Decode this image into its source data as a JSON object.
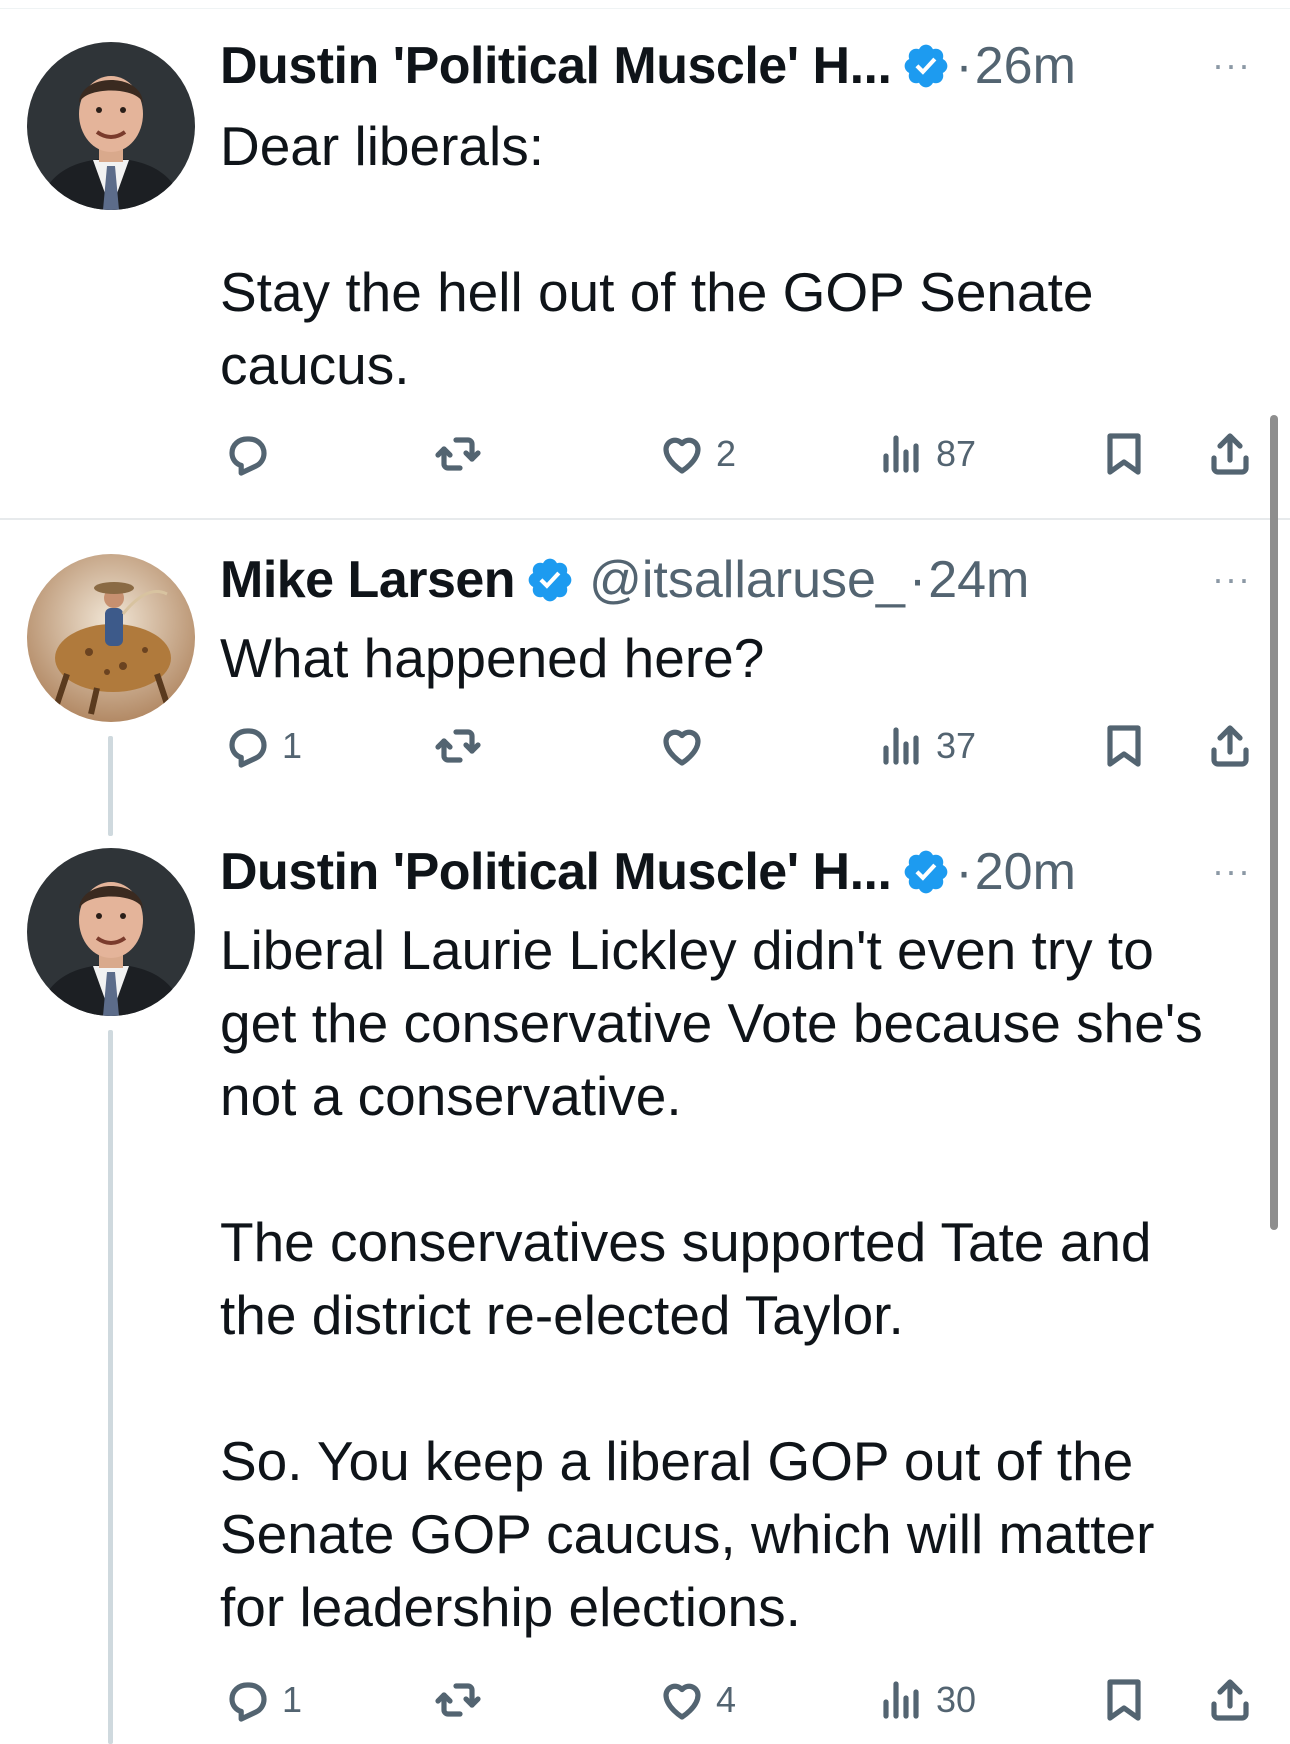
{
  "tweets": [
    {
      "author": "Dustin 'Political Muscle' H...",
      "handle": "",
      "separator": "·",
      "time": "26m",
      "more": "···",
      "paragraphs": [
        "Dear liberals:",
        "Stay the hell out of the GOP Senate caucus."
      ],
      "counts": {
        "replies": "",
        "retweets": "",
        "likes": "2",
        "views": "87"
      }
    },
    {
      "author": "Mike Larsen",
      "handle": "@itsallaruse_",
      "separator": "·",
      "time": "24m",
      "more": "···",
      "paragraphs": [
        "What happened here?"
      ],
      "counts": {
        "replies": "1",
        "retweets": "",
        "likes": "",
        "views": "37"
      }
    },
    {
      "author": "Dustin 'Political Muscle' H...",
      "handle": "",
      "separator": "·",
      "time": "20m",
      "more": "···",
      "paragraphs": [
        "Liberal Laurie Lickley didn't even try to get the conservative Vote because she's not a conservative.",
        "The conservatives supported Tate and the district re-elected Taylor.",
        "So. You keep a liberal GOP out of the Senate GOP caucus, which will matter for leadership elections."
      ],
      "counts": {
        "replies": "1",
        "retweets": "",
        "likes": "4",
        "views": "30"
      }
    }
  ],
  "icons": {
    "reply": "reply-icon",
    "retweet": "retweet-icon",
    "like": "heart-icon",
    "views": "views-icon",
    "bookmark": "bookmark-icon",
    "share": "share-icon",
    "verified": "verified-badge-icon"
  },
  "colors": {
    "verified": "#1d9bf0",
    "secondary_text": "#536471",
    "text": "#0f1419"
  }
}
